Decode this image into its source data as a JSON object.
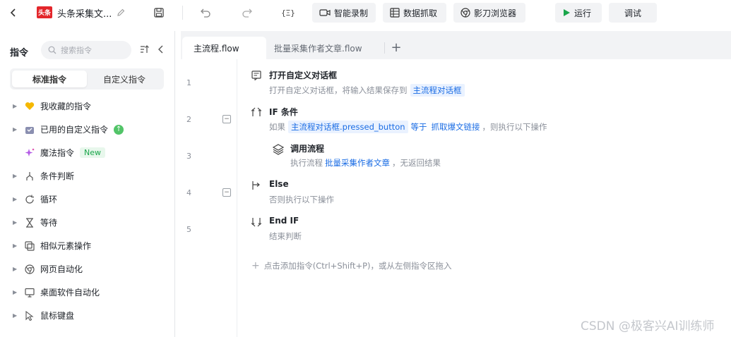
{
  "toolbar": {
    "logo_text": "头条",
    "title": "头条采集文...",
    "buttons": {
      "smart_record": "智能录制",
      "data_capture": "数据抓取",
      "browser": "影刀浏览器",
      "run": "运行",
      "debug": "调试"
    },
    "var_icon": "{Ξ}",
    "icons": [
      "back-icon",
      "edit-icon",
      "save-icon",
      "undo-icon",
      "redo-icon",
      "variable-icon",
      "video-icon",
      "table-icon",
      "browser-icon",
      "play-icon"
    ]
  },
  "sidebar": {
    "heading": "指令",
    "search_placeholder": "搜索指令",
    "tabs": {
      "standard": "标准指令",
      "custom": "自定义指令"
    },
    "items": [
      {
        "label": "我收藏的指令",
        "icon": "heart-icon",
        "caret": true
      },
      {
        "label": "已用的自定义指令",
        "icon": "box-icon",
        "caret": true,
        "upgrade": true
      },
      {
        "label": "魔法指令",
        "icon": "sparkle-icon",
        "caret": false,
        "badge": "New"
      },
      {
        "label": "条件判断",
        "icon": "branch-icon",
        "caret": true
      },
      {
        "label": "循环",
        "icon": "loop-icon",
        "caret": true
      },
      {
        "label": "等待",
        "icon": "hourglass-icon",
        "caret": true
      },
      {
        "label": "相似元素操作",
        "icon": "similar-icon",
        "caret": true
      },
      {
        "label": "网页自动化",
        "icon": "browser-icon",
        "caret": true
      },
      {
        "label": "桌面软件自动化",
        "icon": "monitor-icon",
        "caret": true
      },
      {
        "label": "鼠标键盘",
        "icon": "cursor-icon",
        "caret": true
      }
    ]
  },
  "editor": {
    "tabs": [
      "主流程.flow",
      "批量采集作者文章.flow"
    ],
    "lines": [
      "1",
      "2",
      "3",
      "4",
      "5"
    ],
    "steps": {
      "s1": {
        "title": "打开自定义对话框",
        "desc_prefix": "打开自定义对话框，将输入结果保存到",
        "var": "主流程对话框"
      },
      "s2": {
        "title": "IF 条件",
        "desc_prefix": "如果",
        "var": "主流程对话框.pressed_button",
        "op": "等于",
        "value": "抓取爆文链接",
        "desc_suffix": "，则执行以下操作"
      },
      "s3": {
        "title": "调用流程",
        "desc_prefix": "执行流程",
        "flow": "批量采集作者文章",
        "desc_suffix": "，无返回结果"
      },
      "s4": {
        "title": "Else",
        "desc": "否则执行以下操作"
      },
      "s5": {
        "title": "End IF",
        "desc": "结束判断"
      }
    },
    "add_hint": "点击添加指令(Ctrl+Shift+P)，或从左侧指令区拖入"
  },
  "watermark": "CSDN @极客兴AI训练师",
  "colors": {
    "accent": "#1a6ce4",
    "run_green": "#1aa64b",
    "logo_red": "#e3262b",
    "favorite_yellow": "#f5b800"
  }
}
